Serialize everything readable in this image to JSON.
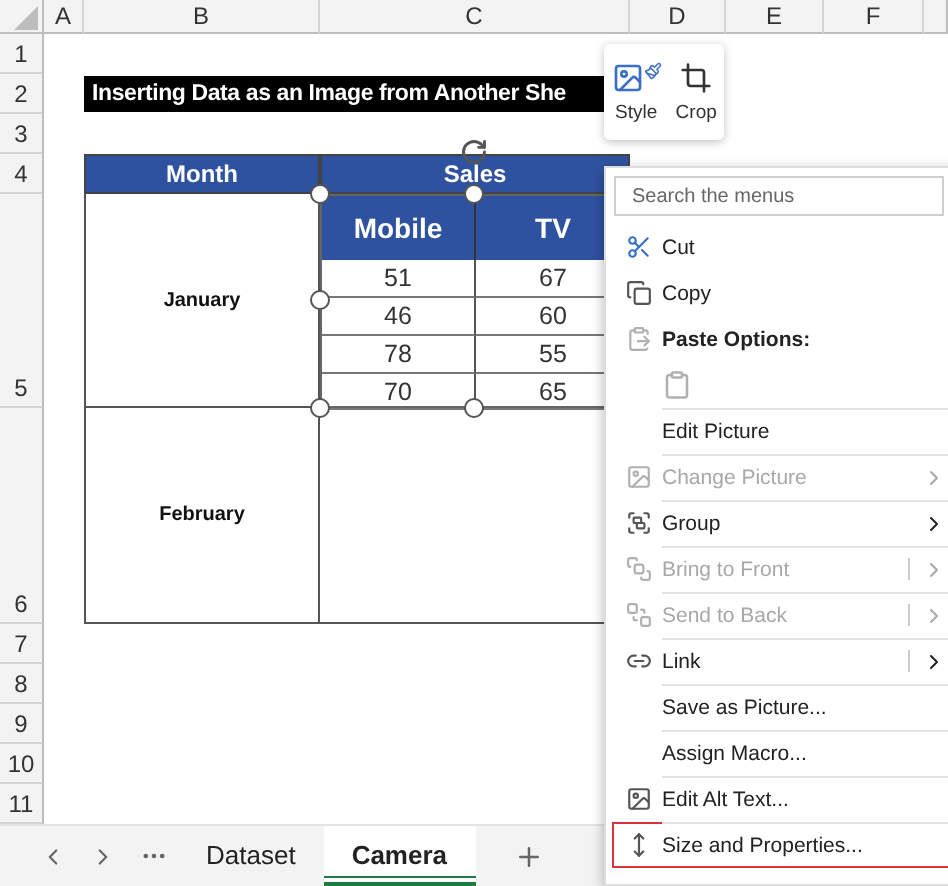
{
  "columns": [
    "A",
    "B",
    "C",
    "D",
    "E",
    "F"
  ],
  "rows": [
    "1",
    "2",
    "3",
    "4",
    "5",
    "6",
    "7",
    "8",
    "9",
    "10",
    "11"
  ],
  "title": "Inserting Data as an Image from Another She",
  "table": {
    "headers": [
      "Month",
      "Sales"
    ],
    "months": [
      "January",
      "February"
    ]
  },
  "picture": {
    "columns": [
      "Mobile",
      "TV"
    ],
    "rows": [
      [
        "51",
        "67"
      ],
      [
        "46",
        "60"
      ],
      [
        "78",
        "55"
      ],
      [
        "70",
        "65"
      ]
    ]
  },
  "mini_toolbar": [
    {
      "label": "Style",
      "kind": "style"
    },
    {
      "label": "Crop",
      "kind": "crop"
    }
  ],
  "context_menu": {
    "search_placeholder": "Search the menus",
    "items": [
      {
        "kind": "command",
        "label": "Cut",
        "disabled": false,
        "submenu": false,
        "split": false,
        "divider": false,
        "highlighted": false
      },
      {
        "kind": "command",
        "label": "Copy",
        "disabled": false,
        "submenu": false,
        "split": false,
        "divider": false,
        "highlighted": false
      },
      {
        "kind": "heading",
        "label": "Paste Options:"
      },
      {
        "kind": "paste-row"
      },
      {
        "kind": "command",
        "label": "Edit Picture",
        "disabled": false,
        "submenu": false,
        "split": false,
        "divider": true,
        "highlighted": false
      },
      {
        "kind": "command",
        "label": "Change Picture",
        "disabled": true,
        "submenu": true,
        "split": false,
        "divider": true,
        "highlighted": false
      },
      {
        "kind": "command",
        "label": "Group",
        "disabled": false,
        "submenu": true,
        "split": false,
        "divider": true,
        "highlighted": false
      },
      {
        "kind": "command",
        "label": "Bring to Front",
        "disabled": true,
        "submenu": true,
        "split": true,
        "divider": true,
        "highlighted": false
      },
      {
        "kind": "command",
        "label": "Send to Back",
        "disabled": true,
        "submenu": true,
        "split": true,
        "divider": true,
        "highlighted": false
      },
      {
        "kind": "command",
        "label": "Link",
        "disabled": false,
        "submenu": true,
        "split": true,
        "divider": true,
        "highlighted": false
      },
      {
        "kind": "command",
        "label": "Save as Picture...",
        "disabled": false,
        "submenu": false,
        "split": false,
        "divider": true,
        "highlighted": false
      },
      {
        "kind": "command",
        "label": "Assign Macro...",
        "disabled": false,
        "submenu": false,
        "split": false,
        "divider": true,
        "highlighted": false
      },
      {
        "kind": "command",
        "label": "Edit Alt Text...",
        "disabled": false,
        "submenu": false,
        "split": false,
        "divider": true,
        "highlighted": false
      },
      {
        "kind": "command",
        "label": "Size and Properties...",
        "disabled": false,
        "submenu": false,
        "split": false,
        "divider": true,
        "highlighted": true
      }
    ]
  },
  "sheet_tabs": [
    {
      "label": "Dataset",
      "selected": false
    },
    {
      "label": "Camera",
      "selected": true
    }
  ]
}
